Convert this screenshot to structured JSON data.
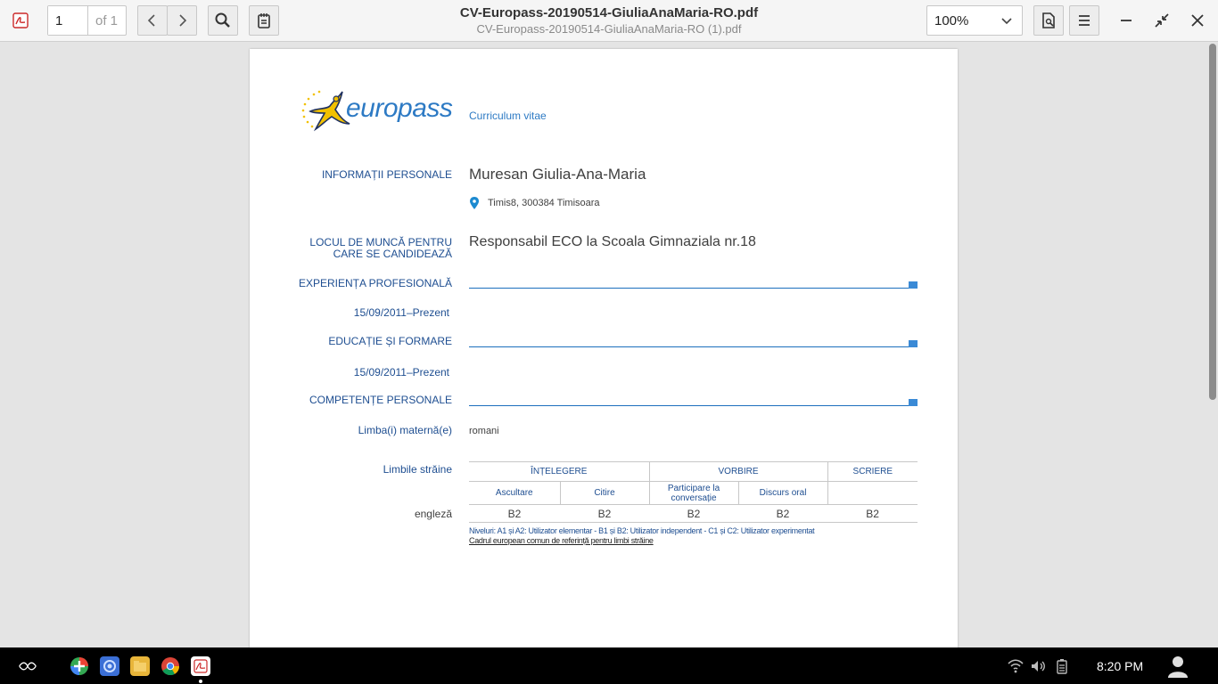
{
  "toolbar": {
    "current_page": "1",
    "page_of": "of 1",
    "title": "CV-Europass-20190514-GiuliaAnaMaria-RO.pdf",
    "subtitle": "CV-Europass-20190514-GiuliaAnaMaria-RO (1).pdf",
    "zoom": "100%",
    "icons": [
      "pdf-logo-icon",
      "chevron-left-icon",
      "chevron-right-icon",
      "search-icon",
      "annotate-icon",
      "document-icon",
      "menu-icon",
      "minimize-icon",
      "restore-icon",
      "close-icon"
    ]
  },
  "cv": {
    "logo_text": "europass",
    "doc_type": "Curriculum vitae",
    "personal_label": "INFORMAȚII PERSONALE",
    "name": "Muresan Giulia-Ana-Maria",
    "address": "Timis8, 300384 Timisoara",
    "job_label_line1": "LOCUL DE MUNCĂ PENTRU",
    "job_label_line2": "CARE SE CANDIDEAZĂ",
    "job": "Responsabil ECO la Scoala Gimnaziala nr.18",
    "experience_label": "EXPERIENȚA PROFESIONALĂ",
    "experience_date": "15/09/2011–Prezent",
    "education_label": "EDUCAȚIE ȘI FORMARE",
    "education_date": "15/09/2011–Prezent",
    "competences_label": "COMPETENȚE PERSONALE",
    "mother_tongue_label": "Limba(i) maternă(e)",
    "mother_tongue": "romani",
    "foreign_label": "Limbile străine",
    "table": {
      "group_understanding": "ÎNȚELEGERE",
      "group_speaking": "VORBIRE",
      "group_writing": "SCRIERE",
      "listening": "Ascultare",
      "reading": "Citire",
      "interaction_line1": "Participare la",
      "interaction_line2": "conversație",
      "production": "Discurs oral",
      "language": "engleză",
      "levels": [
        "B2",
        "B2",
        "B2",
        "B2",
        "B2"
      ]
    },
    "levels_note": "Niveluri: A1 și A2: Utilizator elementar - B1 și B2: Utilizator independent - C1 și C2: Utilizator experimentat",
    "cefr_link": "Cadrul european comun de referință pentru limbi străine"
  },
  "taskbar": {
    "time": "8:20 PM",
    "apps": [
      "launcher-icon",
      "add-app-icon",
      "browser-alt-icon",
      "files-icon",
      "chrome-icon",
      "pdf-app-icon"
    ],
    "tray": [
      "wifi-icon",
      "volume-icon",
      "battery-icon",
      "user-avatar-icon"
    ]
  },
  "colors": {
    "cv_blue": "#1e4e91",
    "rule_blue": "#1c6fbd",
    "toolbar_bg": "#f5f5f5"
  }
}
